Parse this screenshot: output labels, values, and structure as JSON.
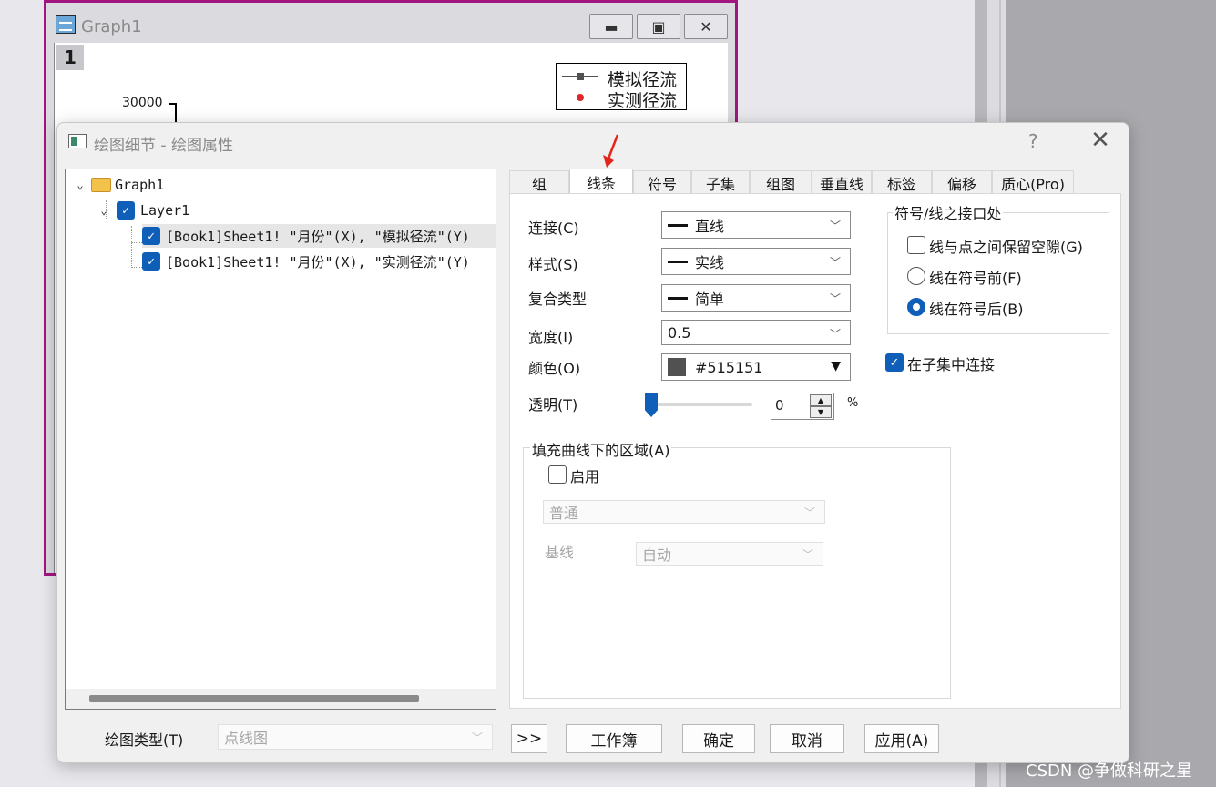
{
  "graph_window": {
    "title": "Graph1",
    "layer_badge": "1",
    "ytick": "30000",
    "legend": [
      {
        "label": "模拟径流",
        "color": "#515151"
      },
      {
        "label": "实测径流",
        "color": "#e0282b"
      }
    ]
  },
  "dialog": {
    "title": "绘图细节 - 绘图属性",
    "help": "?",
    "close": "✕",
    "tree": {
      "root": "Graph1",
      "layer": "Layer1",
      "plots": [
        "[Book1]Sheet1! \"月份\"(X), \"模拟径流\"(Y)",
        "[Book1]Sheet1! \"月份\"(X), \"实测径流\"(Y)"
      ]
    },
    "tabs": [
      "组",
      "线条",
      "符号",
      "子集",
      "组图",
      "垂直线",
      "标签",
      "偏移",
      "质心(Pro)"
    ],
    "active_tab": "线条",
    "line": {
      "connect_label": "连接(C)",
      "connect_value": "直线",
      "style_label": "样式(S)",
      "style_value": "实线",
      "compound_label": "复合类型",
      "compound_value": "简单",
      "width_label": "宽度(I)",
      "width_value": "0.5",
      "color_label": "颜色(O)",
      "color_value": "#515151",
      "color_hex": "#515151",
      "transparency_label": "透明(T)",
      "transparency_value": "0",
      "percent": "%",
      "transparency_level": 0
    },
    "symbol_interface": {
      "title": "符号/线之接口处",
      "gap_option": "线与点之间保留空隙(G)",
      "front_option": "线在符号前(F)",
      "back_option": "线在符号后(B)"
    },
    "subset_connect": "在子集中连接",
    "fill": {
      "title": "填充曲线下的区域(A)",
      "enable": "启用",
      "mode": "普通",
      "baseline_label": "基线",
      "baseline_value": "自动"
    },
    "plot_type_label": "绘图类型(T)",
    "plot_type_value": "点线图",
    "buttons": {
      "expand": ">>",
      "workbook": "工作簿",
      "ok": "确定",
      "cancel": "取消",
      "apply": "应用(A)"
    }
  },
  "watermark": "CSDN @争做科研之星",
  "accent": "#0f5fb8"
}
